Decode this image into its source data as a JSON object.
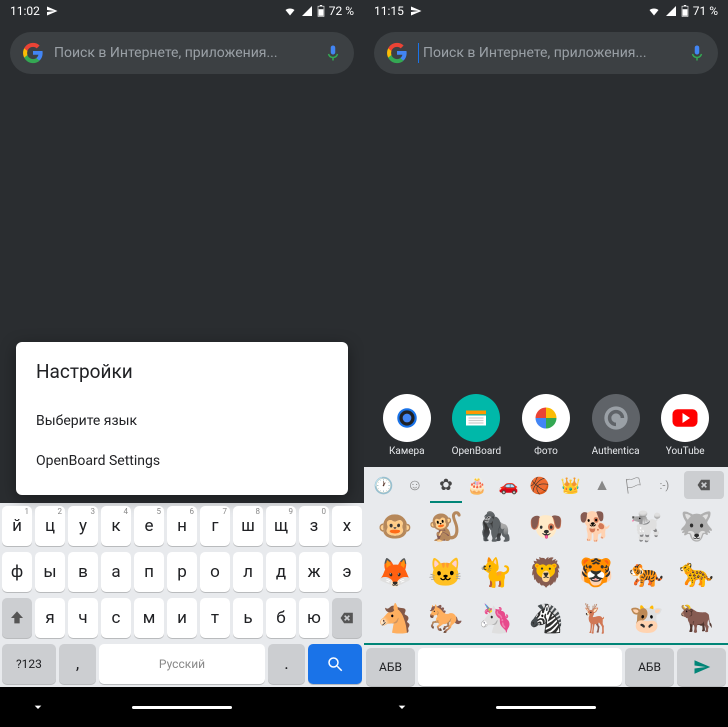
{
  "left": {
    "status": {
      "time": "11:02",
      "battery": "72 %"
    },
    "search": {
      "placeholder": "Поиск в Интернете, приложения..."
    },
    "popup": {
      "title": "Настройки",
      "items": [
        "Выберите язык",
        "OpenBoard Settings"
      ]
    },
    "keyboard": {
      "row1": [
        {
          "k": "й",
          "n": "1"
        },
        {
          "k": "ц",
          "n": "2"
        },
        {
          "k": "у",
          "n": "3"
        },
        {
          "k": "к",
          "n": "4"
        },
        {
          "k": "е",
          "n": "5"
        },
        {
          "k": "н",
          "n": "6"
        },
        {
          "k": "г",
          "n": "7"
        },
        {
          "k": "ш",
          "n": "8"
        },
        {
          "k": "щ",
          "n": "9"
        },
        {
          "k": "з",
          "n": "0"
        },
        {
          "k": "х",
          "n": ""
        }
      ],
      "row2": [
        {
          "k": "ф"
        },
        {
          "k": "ы"
        },
        {
          "k": "в"
        },
        {
          "k": "а"
        },
        {
          "k": "п"
        },
        {
          "k": "р"
        },
        {
          "k": "о"
        },
        {
          "k": "л"
        },
        {
          "k": "д"
        },
        {
          "k": "ж"
        },
        {
          "k": "э"
        }
      ],
      "row3": [
        {
          "k": "я"
        },
        {
          "k": "ч"
        },
        {
          "k": "с"
        },
        {
          "k": "м"
        },
        {
          "k": "и"
        },
        {
          "k": "т"
        },
        {
          "k": "ь"
        },
        {
          "k": "б"
        },
        {
          "k": "ю"
        }
      ],
      "bottom": {
        "symbols": "?123",
        "comma": ",",
        "space": "Русский",
        "period": "."
      }
    }
  },
  "right": {
    "status": {
      "time": "11:15",
      "battery": "71 %"
    },
    "search": {
      "placeholder": "Поиск в Интернете, приложения..."
    },
    "apps": [
      {
        "label": "Камера",
        "icon": "camera",
        "bg": "#fff"
      },
      {
        "label": "OpenBoard",
        "icon": "openboard",
        "bg": "#00b8a9"
      },
      {
        "label": "Фото",
        "icon": "photos",
        "bg": "#fff"
      },
      {
        "label": "Authentica",
        "icon": "auth",
        "bg": "#5f6368"
      },
      {
        "label": "YouTube",
        "icon": "youtube",
        "bg": "#fff"
      }
    ],
    "emoji_keyboard": {
      "categories": [
        "recent",
        "smiley",
        "flower",
        "cake",
        "car",
        "ball",
        "crown",
        "triangle",
        "flag",
        "text"
      ],
      "emojis": [
        "🐵",
        "🐒",
        "🦍",
        "🐶",
        "🐕",
        "🐩",
        "🐺",
        "🦊",
        "🐱",
        "🐈",
        "🦁",
        "🐯",
        "🐅",
        "🐆",
        "🐴",
        "🐎",
        "🦄",
        "🦓",
        "🦌",
        "🐮",
        "🐂"
      ],
      "bottom": {
        "abc_left": "АБВ",
        "abc_right": "АБВ"
      }
    }
  }
}
